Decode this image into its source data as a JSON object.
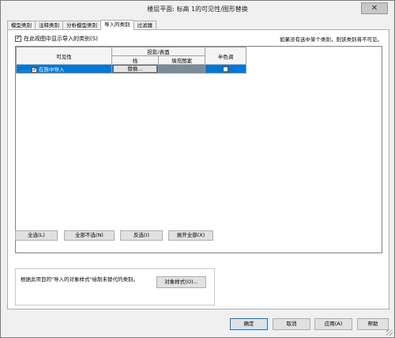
{
  "window": {
    "title": "楼层平面: 标高 1的可见性/图形替换",
    "close_glyph": "✕"
  },
  "tabs": [
    {
      "label": "模型类别"
    },
    {
      "label": "注释类别"
    },
    {
      "label": "分析模型类别"
    },
    {
      "label": "导入的类别"
    },
    {
      "label": "过滤器"
    }
  ],
  "active_tab": "导入的类别",
  "show_categories": {
    "label": "在此视图中显示导入的类别(S)",
    "checked": true
  },
  "hint": "如果没有选中某个类别，则该类别将不可见。",
  "grid": {
    "headers": {
      "visibility": "可见性",
      "projection_surface": "投影/表面",
      "line": "线",
      "fill_pattern": "填充图案",
      "halftone": "半色调"
    },
    "rows": [
      {
        "name": "在族中导入",
        "visible": true,
        "line_button": "替换...",
        "halftone": false,
        "selected": true
      }
    ]
  },
  "buttons": {
    "select_all": "全选(L)",
    "select_none": "全部不选(N)",
    "invert": "反选(I)",
    "expand_all": "展开全部(X)"
  },
  "object_style_group": {
    "text": "根据此项目的\"导入的对象样式\"绘制未替代的类别。",
    "button": "对象样式(O)..."
  },
  "footer": {
    "ok": "确定",
    "cancel": "取消",
    "apply": "应用(A)",
    "help": "帮助"
  }
}
